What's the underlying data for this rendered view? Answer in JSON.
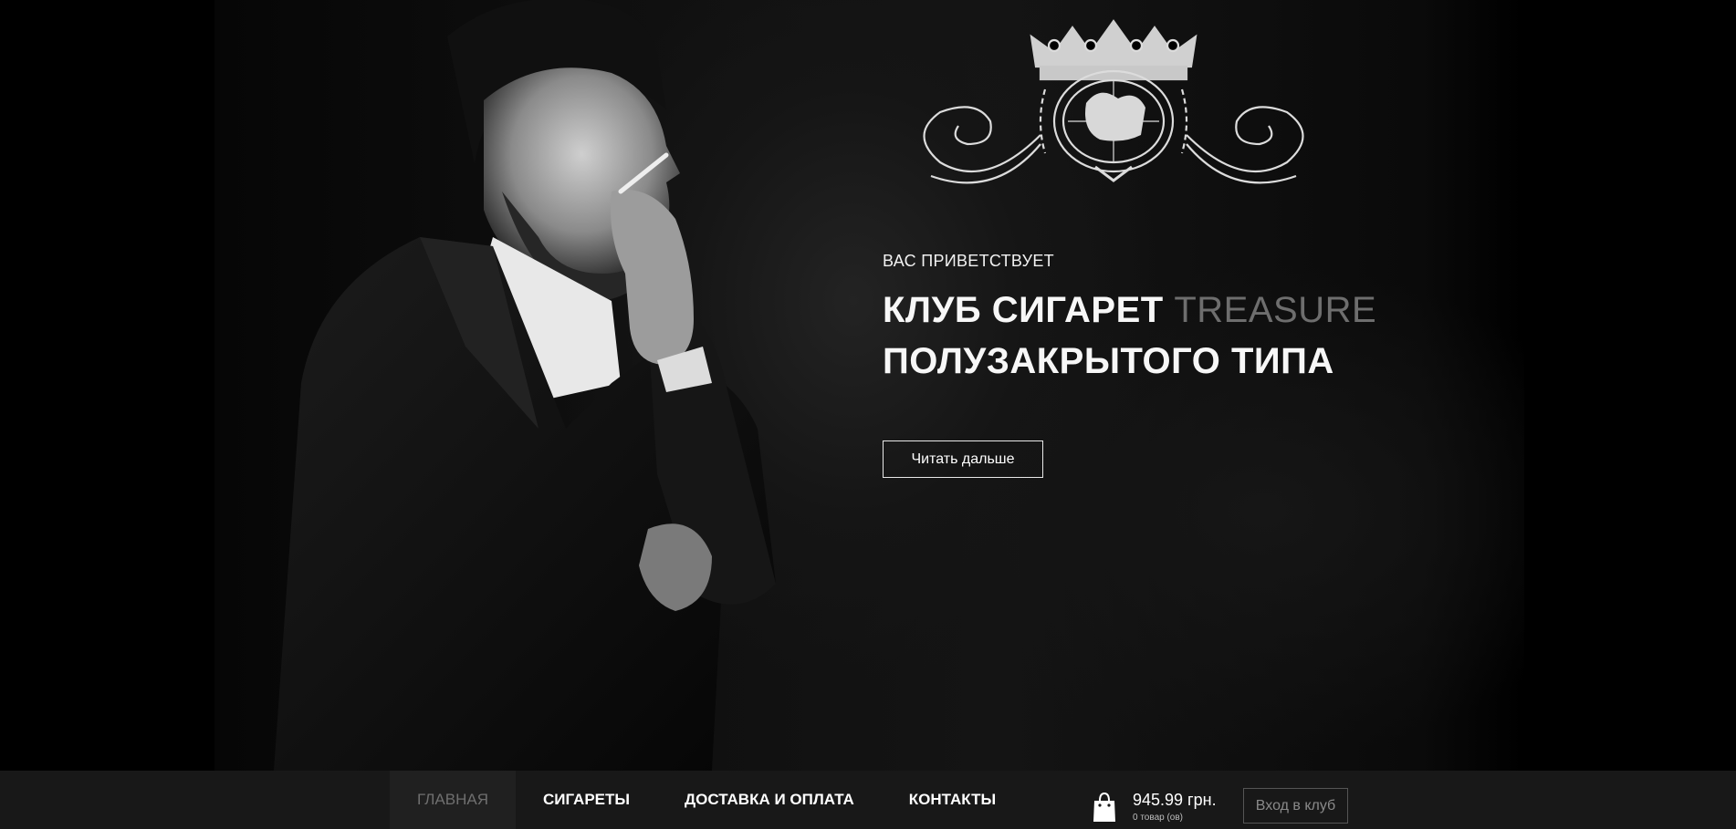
{
  "hero": {
    "greeting": "ВАС ПРИВЕТСТВУЕТ",
    "headline_line1": "КЛУБ СИГАРЕТ",
    "headline_accent": "TREASURE",
    "headline_line2": "ПОЛУЗАКРЫТОГО ТИПА",
    "read_more_label": "Читать дальше"
  },
  "nav": {
    "items": [
      {
        "label": "ГЛАВНАЯ",
        "active": true
      },
      {
        "label": "СИГАРЕТЫ",
        "active": false
      },
      {
        "label": "ДОСТАВКА И ОПЛАТА",
        "active": false
      },
      {
        "label": "КОНТАКТЫ",
        "active": false
      }
    ]
  },
  "cart": {
    "icon": "shopping-bag-icon",
    "price": "945.99 грн.",
    "count": "0 товар (ов)"
  },
  "login_label": "Вход в клуб",
  "colors": {
    "background": "#000000",
    "navbar": "#181818",
    "accent_gray": "#6e6e6e"
  }
}
